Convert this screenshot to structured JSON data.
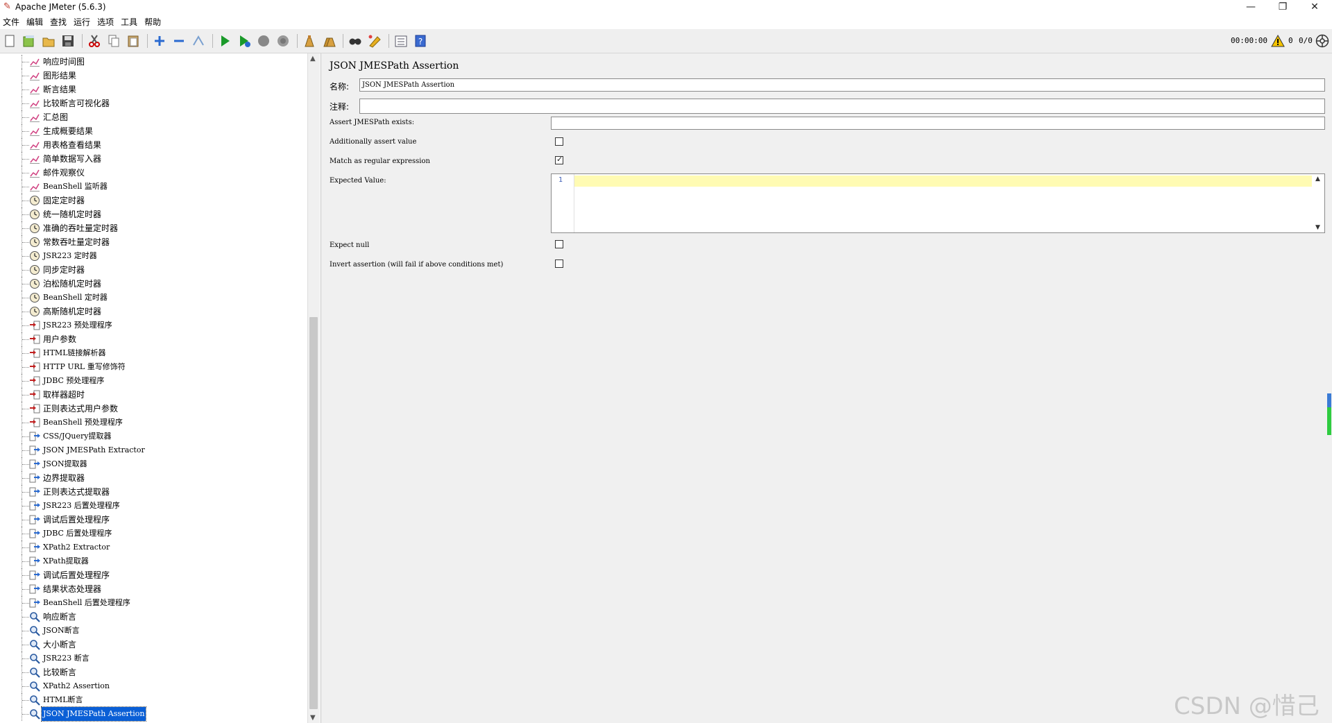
{
  "window": {
    "title": "Apache JMeter (5.6.3)",
    "minimize_glyph": "—",
    "restore_glyph": "❐",
    "close_glyph": "✕"
  },
  "menu": [
    "文件",
    "编辑",
    "查找",
    "运行",
    "选项",
    "工具",
    "帮助"
  ],
  "toolbar": {
    "timer": "00:00:00",
    "warning_count": "0",
    "thread_count": "0/0",
    "buttons": [
      "new-icon",
      "templates-icon",
      "open-icon",
      "save-icon",
      "cut-icon",
      "copy-icon",
      "paste-icon",
      "expand-icon",
      "collapse-icon",
      "toggle-icon",
      "start-icon",
      "start-no-pause-icon",
      "stop-icon",
      "shutdown-icon",
      "clear-icon",
      "clear-all-icon",
      "search-icon",
      "reset-search-icon",
      "function-helper-icon",
      "help-icon"
    ]
  },
  "tree": {
    "items": [
      {
        "label": "响应时间图",
        "type": "listener"
      },
      {
        "label": "图形结果",
        "type": "listener"
      },
      {
        "label": "断言结果",
        "type": "listener"
      },
      {
        "label": "比较断言可视化器",
        "type": "listener"
      },
      {
        "label": "汇总图",
        "type": "listener"
      },
      {
        "label": "生成概要结果",
        "type": "listener"
      },
      {
        "label": "用表格查看结果",
        "type": "listener"
      },
      {
        "label": "简单数据写入器",
        "type": "listener"
      },
      {
        "label": "邮件观察仪",
        "type": "listener"
      },
      {
        "label": "BeanShell 监听器",
        "type": "listener"
      },
      {
        "label": "固定定时器",
        "type": "timer"
      },
      {
        "label": "统一随机定时器",
        "type": "timer"
      },
      {
        "label": "准确的吞吐量定时器",
        "type": "timer"
      },
      {
        "label": "常数吞吐量定时器",
        "type": "timer"
      },
      {
        "label": "JSR223 定时器",
        "type": "timer"
      },
      {
        "label": "同步定时器",
        "type": "timer"
      },
      {
        "label": "泊松随机定时器",
        "type": "timer"
      },
      {
        "label": "BeanShell 定时器",
        "type": "timer"
      },
      {
        "label": "高斯随机定时器",
        "type": "timer"
      },
      {
        "label": "JSR223 预处理程序",
        "type": "pre"
      },
      {
        "label": "用户参数",
        "type": "pre"
      },
      {
        "label": "HTML链接解析器",
        "type": "pre"
      },
      {
        "label": "HTTP URL 重写修饰符",
        "type": "pre"
      },
      {
        "label": "JDBC 预处理程序",
        "type": "pre"
      },
      {
        "label": "取样器超时",
        "type": "pre"
      },
      {
        "label": "正则表达式用户参数",
        "type": "pre"
      },
      {
        "label": "BeanShell 预处理程序",
        "type": "pre"
      },
      {
        "label": "CSS/JQuery提取器",
        "type": "post"
      },
      {
        "label": "JSON JMESPath Extractor",
        "type": "post"
      },
      {
        "label": "JSON提取器",
        "type": "post"
      },
      {
        "label": "边界提取器",
        "type": "post"
      },
      {
        "label": "正则表达式提取器",
        "type": "post"
      },
      {
        "label": "JSR223 后置处理程序",
        "type": "post"
      },
      {
        "label": "调试后置处理程序",
        "type": "post"
      },
      {
        "label": "JDBC 后置处理程序",
        "type": "post"
      },
      {
        "label": "XPath2 Extractor",
        "type": "post"
      },
      {
        "label": "XPath提取器",
        "type": "post"
      },
      {
        "label": "调试后置处理程序",
        "type": "post"
      },
      {
        "label": "结果状态处理器",
        "type": "post"
      },
      {
        "label": "BeanShell 后置处理程序",
        "type": "post"
      },
      {
        "label": "响应断言",
        "type": "assert"
      },
      {
        "label": "JSON断言",
        "type": "assert"
      },
      {
        "label": "大小断言",
        "type": "assert"
      },
      {
        "label": "JSR223 断言",
        "type": "assert"
      },
      {
        "label": "比较断言",
        "type": "assert"
      },
      {
        "label": "XPath2 Assertion",
        "type": "assert"
      },
      {
        "label": "HTML断言",
        "type": "assert"
      },
      {
        "label": "JSON JMESPath Assertion",
        "type": "assert",
        "selected": true
      }
    ],
    "scroll_up": "▲",
    "scroll_down": "▼"
  },
  "detail": {
    "title": "JSON JMESPath Assertion",
    "name_label": "名称:",
    "name_value": "JSON JMESPath Assertion",
    "comment_label": "注释:",
    "comment_value": "",
    "assert_path_label": "Assert JMESPath exists:",
    "assert_path_value": "",
    "additionally_label": "Additionally assert value",
    "additionally_checked": false,
    "regex_label": "Match as regular expression",
    "regex_checked": true,
    "expected_label": "Expected Value:",
    "expected_line_no": "1",
    "expected_value": "",
    "expect_null_label": "Expect null",
    "expect_null_checked": false,
    "invert_label": "Invert assertion (will fail if above conditions met)",
    "invert_checked": false,
    "tick_glyph": "✓"
  },
  "watermark": "CSDN @惜己"
}
